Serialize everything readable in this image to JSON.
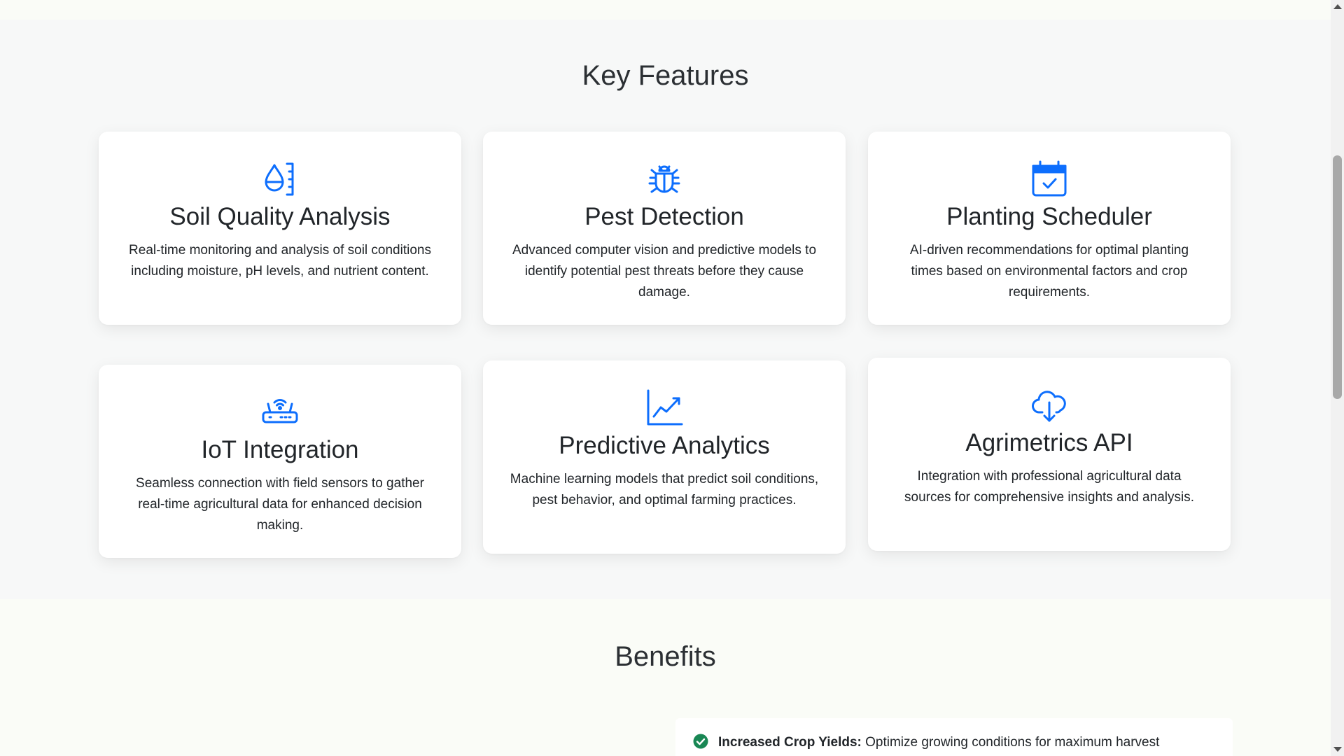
{
  "colors": {
    "accent": "#0d6efd",
    "check": "#198754"
  },
  "features": {
    "title": "Key Features",
    "cards": [
      {
        "icon": "droplet-ruler-icon",
        "title": "Soil Quality Analysis",
        "desc": "Real-time monitoring and analysis of soil conditions including moisture, pH levels, and nutrient content."
      },
      {
        "icon": "bug-icon",
        "title": "Pest Detection",
        "desc": "Advanced computer vision and predictive models to identify potential pest threats before they cause damage."
      },
      {
        "icon": "calendar-check-icon",
        "title": "Planting Scheduler",
        "desc": "AI-driven recommendations for optimal planting times based on environmental factors and crop requirements."
      },
      {
        "icon": "router-icon",
        "title": "IoT Integration",
        "desc": "Seamless connection with field sensors to gather real-time agricultural data for enhanced decision making."
      },
      {
        "icon": "graph-up-icon",
        "title": "Predictive Analytics",
        "desc": "Machine learning models that predict soil conditions, pest behavior, and optimal farming practices."
      },
      {
        "icon": "cloud-download-icon",
        "title": "Agrimetrics API",
        "desc": "Integration with professional agricultural data sources for comprehensive insights and analysis."
      }
    ]
  },
  "benefits": {
    "title": "Benefits",
    "items": [
      {
        "icon": "check-circle-icon",
        "label": "Increased Crop Yields:",
        "text": " Optimize growing conditions for maximum harvest"
      }
    ]
  }
}
